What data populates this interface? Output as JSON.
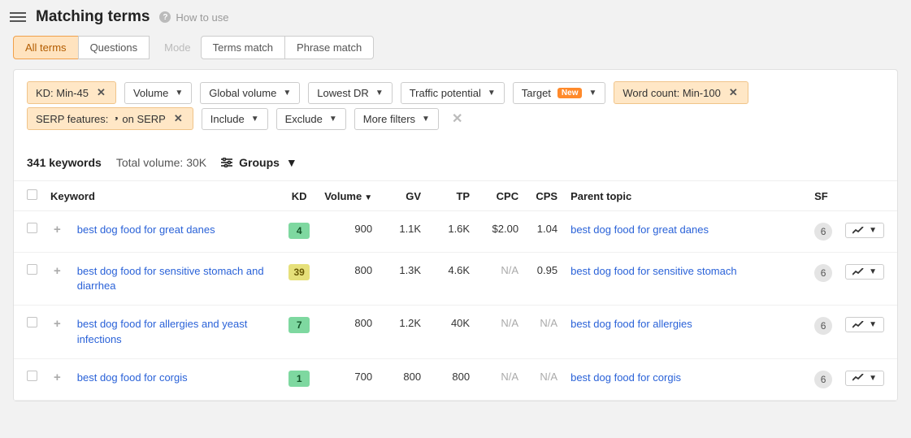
{
  "header": {
    "title": "Matching terms",
    "how_to_use": "How to use"
  },
  "tabs": {
    "all_terms": "All terms",
    "questions": "Questions",
    "mode_label": "Mode",
    "terms_match": "Terms match",
    "phrase_match": "Phrase match"
  },
  "filters": {
    "kd": "KD: Min-45",
    "volume": "Volume",
    "global_volume": "Global volume",
    "lowest_dr": "Lowest DR",
    "traffic_potential": "Traffic potential",
    "target": "Target",
    "target_badge": "New",
    "word_count": "Word count: Min-100",
    "serp_features": "SERP features:",
    "serp_on": "on SERP",
    "include": "Include",
    "exclude": "Exclude",
    "more_filters": "More filters"
  },
  "summary": {
    "keywords_count": "341 keywords",
    "total_volume": "Total volume: 30K",
    "groups": "Groups"
  },
  "columns": {
    "keyword": "Keyword",
    "kd": "KD",
    "volume": "Volume",
    "gv": "GV",
    "tp": "TP",
    "cpc": "CPC",
    "cps": "CPS",
    "parent_topic": "Parent topic",
    "sf": "SF"
  },
  "rows": [
    {
      "keyword": "best dog food for great danes",
      "kd": "4",
      "kd_class": "kd-low",
      "volume": "900",
      "gv": "1.1K",
      "tp": "1.6K",
      "cpc": "$2.00",
      "cps": "1.04",
      "parent": "best dog food for great danes",
      "sf": "6"
    },
    {
      "keyword": "best dog food for sensitive stomach and diarrhea",
      "kd": "39",
      "kd_class": "kd-med",
      "volume": "800",
      "gv": "1.3K",
      "tp": "4.6K",
      "cpc": "N/A",
      "cps": "0.95",
      "parent": "best dog food for sensitive stomach",
      "sf": "6"
    },
    {
      "keyword": "best dog food for allergies and yeast infections",
      "kd": "7",
      "kd_class": "kd-low",
      "volume": "800",
      "gv": "1.2K",
      "tp": "40K",
      "cpc": "N/A",
      "cps": "N/A",
      "parent": "best dog food for allergies",
      "sf": "6"
    },
    {
      "keyword": "best dog food for corgis",
      "kd": "1",
      "kd_class": "kd-low",
      "volume": "700",
      "gv": "800",
      "tp": "800",
      "cpc": "N/A",
      "cps": "N/A",
      "parent": "best dog food for corgis",
      "sf": "6"
    }
  ]
}
